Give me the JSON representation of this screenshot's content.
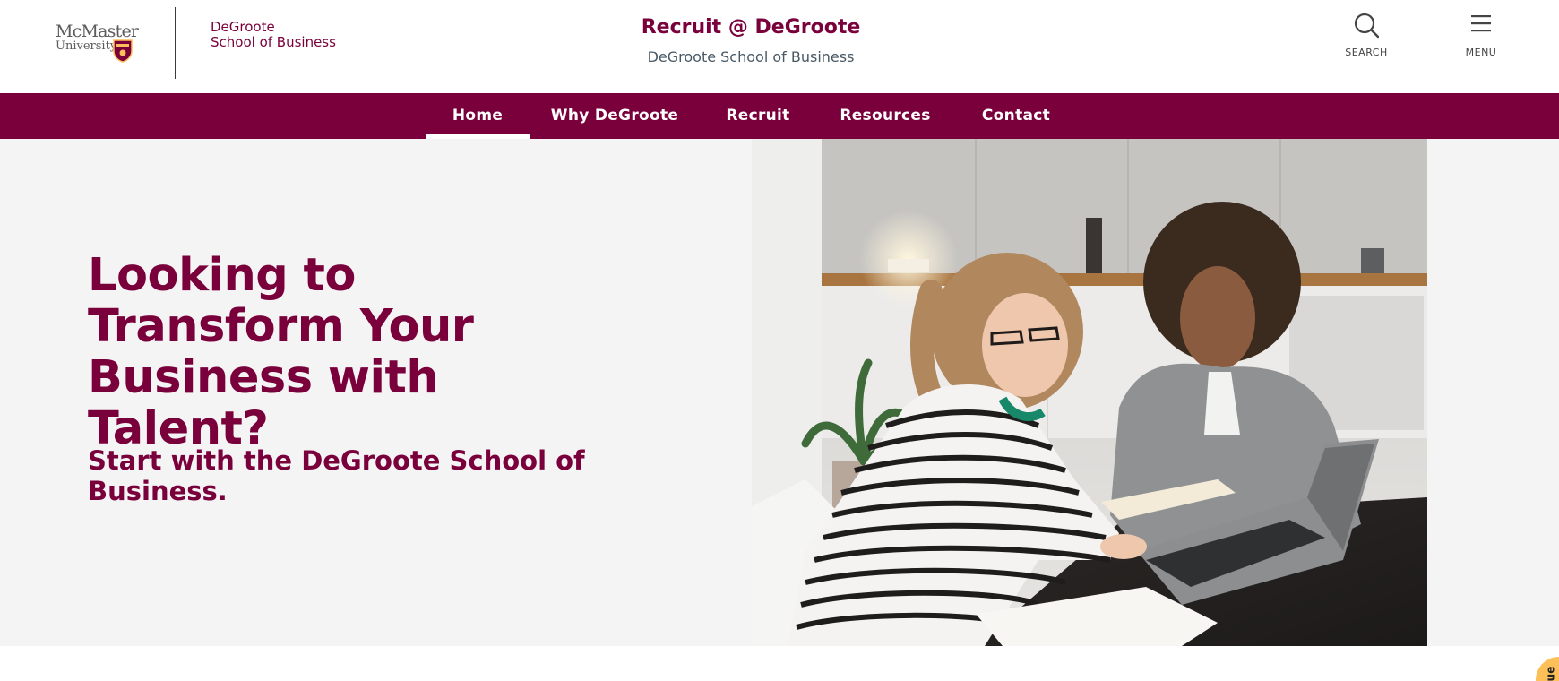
{
  "header": {
    "mcmaster_logo": {
      "line1": "McMaster",
      "line2": "University"
    },
    "dsb_logo": {
      "line1": "DeGroote",
      "line2": "School of Business"
    },
    "site_title": "Recruit @ DeGroote",
    "site_subtitle": "DeGroote School of Business",
    "search": {
      "label": "SEARCH",
      "icon": "search-icon"
    },
    "menu": {
      "label": "MENU",
      "icon": "hamburger-icon"
    }
  },
  "nav": {
    "items": [
      {
        "label": "Home",
        "active": true
      },
      {
        "label": "Why DeGroote",
        "active": false
      },
      {
        "label": "Recruit",
        "active": false
      },
      {
        "label": "Resources",
        "active": false
      },
      {
        "label": "Contact",
        "active": false
      }
    ]
  },
  "hero": {
    "heading": "Looking to Transform Your Business with Talent?",
    "subheading": "Start with the DeGroote School of Business."
  },
  "feedback": {
    "label": "ue"
  },
  "colors": {
    "brand_maroon": "#7a003c",
    "hero_bg": "#f4f4f4",
    "accent_gold": "#fdbf57"
  }
}
